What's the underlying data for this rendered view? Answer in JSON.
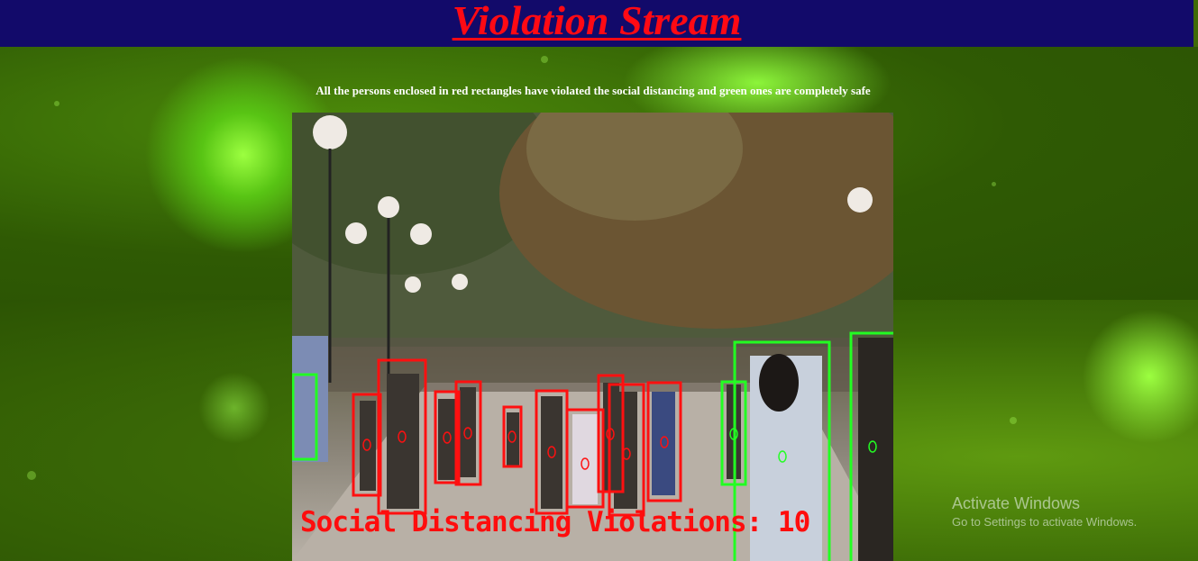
{
  "header": {
    "title": "Violation Stream"
  },
  "description": "All the persons enclosed in red rectangles have violated the social distancing and green ones are completely safe",
  "stream": {
    "overlay_text": "Social Distancing Violations: 10"
  },
  "watermark": {
    "line1": "Activate Windows",
    "line2": "Go to Settings to activate Windows."
  },
  "colors": {
    "header_bg": "#120a6a",
    "title": "#ff0a14",
    "violation_box": "#ff1010",
    "safe_box": "#22ff22"
  }
}
